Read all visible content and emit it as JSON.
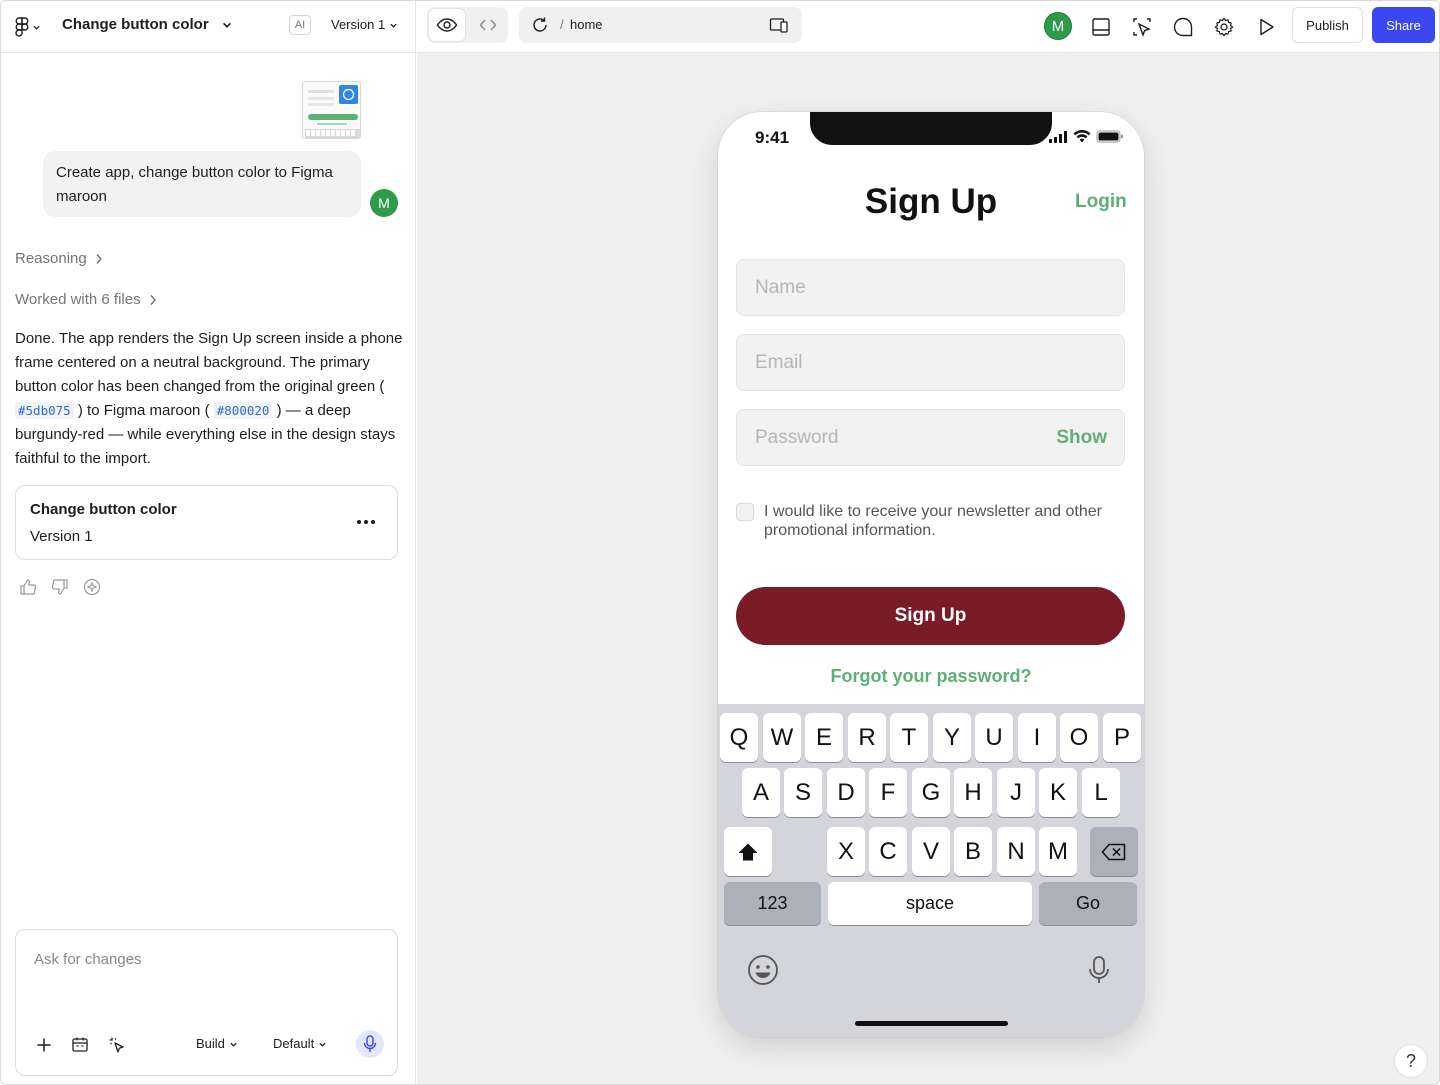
{
  "topbar": {
    "project_title": "Change button color",
    "ai_badge": "AI",
    "version": "Version 1",
    "url_slash": "/",
    "url_path": "home",
    "avatar_initial": "M",
    "publish_label": "Publish",
    "share_label": "Share"
  },
  "chat": {
    "user_message": "Create app, change button color to Figma maroon",
    "user_avatar": "M",
    "reasoning_label": "Reasoning",
    "worked_label": "Worked with 6 files",
    "response_p1": "Done. The app renders the Sign Up screen inside a phone frame centered on a neutral background. The primary button color has been changed from the original green (",
    "response_code1": "#5db075",
    "response_p2": ") to Figma maroon (",
    "response_code2": "#800020",
    "response_p3": ") — a deep burgundy-red — while everything else in the design stays faithful to the import.",
    "version_card": {
      "title": "Change button color",
      "version": "Version 1"
    },
    "composer": {
      "placeholder": "Ask for changes",
      "mode": "Build",
      "model": "Default"
    }
  },
  "phone": {
    "time": "9:41",
    "title": "Sign Up",
    "login": "Login",
    "name_placeholder": "Name",
    "email_placeholder": "Email",
    "password_placeholder": "Password",
    "show_label": "Show",
    "newsletter_label": "I would like to receive your newsletter and other promotional information.",
    "signup_button": "Sign Up",
    "forgot_password": "Forgot your password?",
    "keyboard": {
      "row1": [
        "Q",
        "W",
        "E",
        "R",
        "T",
        "Y",
        "U",
        "I",
        "O",
        "P"
      ],
      "row2": [
        "A",
        "S",
        "D",
        "F",
        "G",
        "H",
        "J",
        "K",
        "L"
      ],
      "row3": [
        "X",
        "C",
        "V",
        "B",
        "N",
        "M"
      ],
      "numbers": "123",
      "space": "space",
      "go": "Go"
    }
  },
  "help_label": "?",
  "colors": {
    "accent_green": "#5db075",
    "maroon_button": "#7a1b28",
    "share_blue": "#3b47f0",
    "avatar_green": "#2e9b4b"
  },
  "icons": [
    "figma-logo-icon",
    "chevron-down-icon",
    "eye-icon",
    "code-icon",
    "refresh-icon",
    "device-icon",
    "layout-icon",
    "inspect-icon",
    "comment-icon",
    "gear-icon",
    "play-icon",
    "chevron-right-icon",
    "more-icon",
    "thumbs-up-icon",
    "thumbs-down-icon",
    "sparkle-icon",
    "plus-icon",
    "calendar-icon",
    "magic-cursor-icon",
    "mic-icon",
    "shift-icon",
    "backspace-icon",
    "emoji-icon"
  ]
}
